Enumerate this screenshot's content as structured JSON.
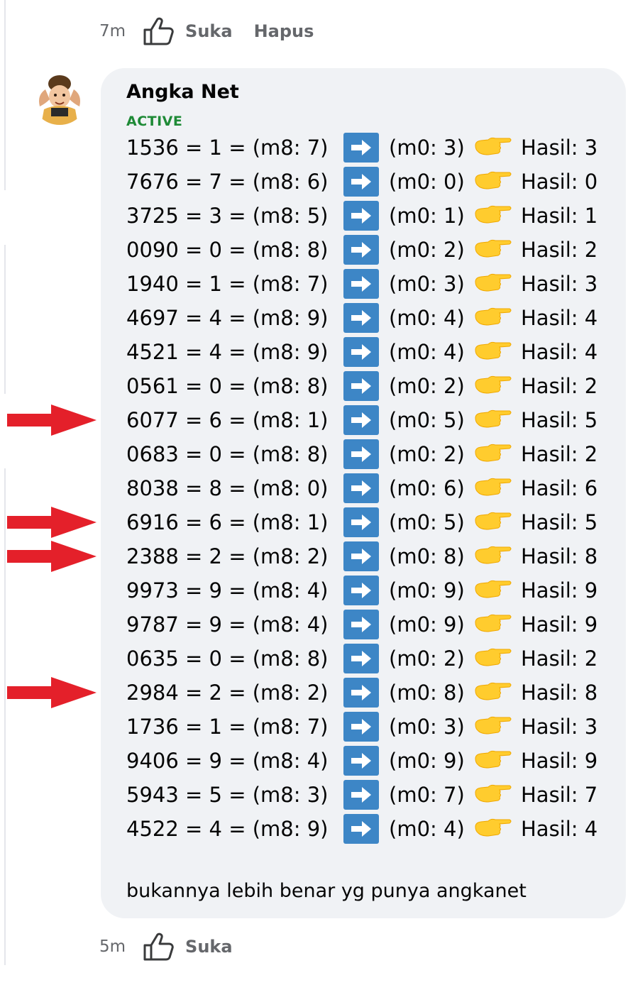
{
  "top_actions": {
    "time": "7m",
    "like_label": "Suka",
    "delete_label": "Hapus"
  },
  "comment": {
    "author": "Angka Net",
    "badge": "ACTIVE",
    "lines": [
      {
        "equation": "1536 = 1 = (m8: 7)",
        "m0": "(m0: 3)",
        "hasil": "Hasil: 3"
      },
      {
        "equation": "7676 = 7 = (m8: 6)",
        "m0": "(m0: 0)",
        "hasil": "Hasil: 0"
      },
      {
        "equation": "3725 = 3 = (m8: 5)",
        "m0": "(m0: 1)",
        "hasil": "Hasil: 1"
      },
      {
        "equation": "0090 = 0 = (m8: 8)",
        "m0": "(m0: 2)",
        "hasil": "Hasil: 2"
      },
      {
        "equation": "1940 = 1 = (m8: 7)",
        "m0": "(m0: 3)",
        "hasil": "Hasil: 3"
      },
      {
        "equation": "4697 = 4 = (m8: 9)",
        "m0": "(m0: 4)",
        "hasil": "Hasil: 4"
      },
      {
        "equation": "4521 = 4 = (m8: 9)",
        "m0": "(m0: 4)",
        "hasil": "Hasil: 4"
      },
      {
        "equation": "0561 = 0 = (m8: 8)",
        "m0": "(m0: 2)",
        "hasil": "Hasil: 2"
      },
      {
        "equation": "6077 = 6 = (m8: 1)",
        "m0": "(m0: 5)",
        "hasil": "Hasil: 5"
      },
      {
        "equation": "0683 = 0 = (m8: 8)",
        "m0": "(m0: 2)",
        "hasil": "Hasil: 2"
      },
      {
        "equation": "8038 = 8 = (m8: 0)",
        "m0": "(m0: 6)",
        "hasil": "Hasil: 6"
      },
      {
        "equation": "6916 = 6 = (m8: 1)",
        "m0": "(m0: 5)",
        "hasil": "Hasil: 5"
      },
      {
        "equation": "2388 = 2 = (m8: 2)",
        "m0": "(m0: 8)",
        "hasil": "Hasil: 8"
      },
      {
        "equation": "9973 = 9 = (m8: 4)",
        "m0": "(m0: 9)",
        "hasil": "Hasil: 9"
      },
      {
        "equation": "9787 = 9 = (m8: 4)",
        "m0": "(m0: 9)",
        "hasil": "Hasil: 9"
      },
      {
        "equation": "0635 = 0 = (m8: 8)",
        "m0": "(m0: 2)",
        "hasil": "Hasil: 2"
      },
      {
        "equation": "2984 = 2 = (m8: 2)",
        "m0": "(m0: 8)",
        "hasil": "Hasil: 8"
      },
      {
        "equation": "1736 = 1 = (m8: 7)",
        "m0": "(m0: 3)",
        "hasil": "Hasil: 3"
      },
      {
        "equation": "9406 = 9 = (m8: 4)",
        "m0": "(m0: 9)",
        "hasil": "Hasil: 9"
      },
      {
        "equation": "5943 = 5 = (m8: 3)",
        "m0": "(m0: 7)",
        "hasil": "Hasil: 7"
      },
      {
        "equation": "4522 = 4 = (m8: 9)",
        "m0": "(m0: 4)",
        "hasil": "Hasil: 4"
      }
    ],
    "message": "bukannya lebih benar yg punya angkanet"
  },
  "bottom_actions": {
    "time": "5m",
    "like_label": "Suka"
  },
  "highlighted_lines": [
    "6077",
    "6916",
    "2388",
    "2984"
  ],
  "colors": {
    "bubble": "#f0f2f5",
    "arrow_box": "#3d86c6",
    "hand": "#ffcc2e",
    "annotation_arrow": "#e4202a",
    "active_badge": "#1e8a36"
  }
}
